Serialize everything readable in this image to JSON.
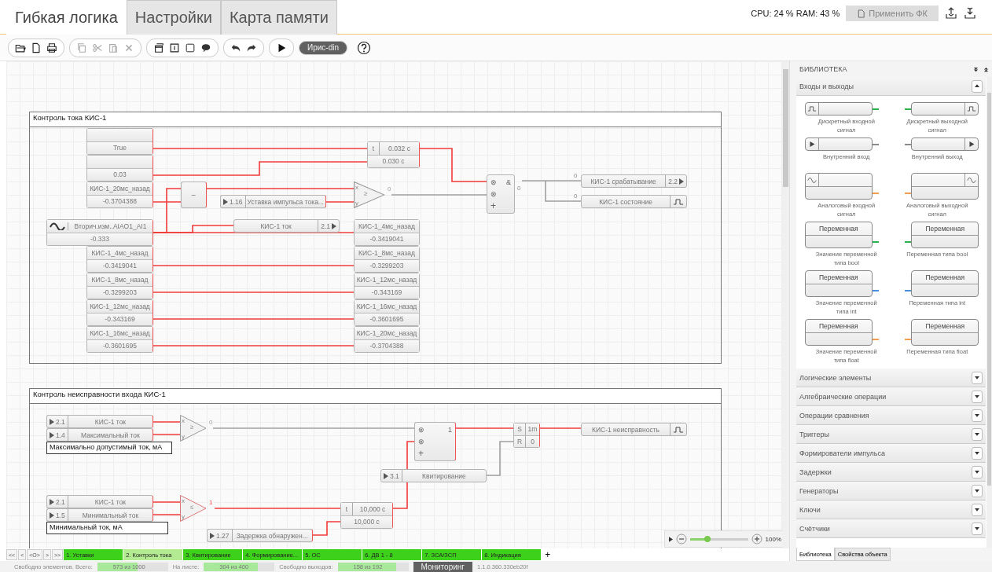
{
  "tabs": [
    {
      "label": "Гибкая логика",
      "selected": true
    },
    {
      "label": "Настройки",
      "selected": false
    },
    {
      "label": "Карта памяти",
      "selected": false
    }
  ],
  "system": {
    "usage": "CPU: 24 % RAM: 43 %",
    "apply_button": "Применить ФК"
  },
  "toolbar": {
    "edit_tools_disabled": true,
    "mode_button": "Ирис-din"
  },
  "diagram": {
    "groups": [
      {
        "title": "Контроль тока КИС-1"
      },
      {
        "title": "Контроль неисправности входа КИС-1"
      }
    ],
    "blocks": [
      {
        "kind": "const",
        "value": "True",
        "active": true
      },
      {
        "kind": "delay",
        "symbol": "t",
        "value": "0.032 с",
        "setting": "0.030 с",
        "active": true
      },
      {
        "kind": "const",
        "value": "0.03",
        "active": true
      },
      {
        "kind": "and",
        "inputs": [
          "⊗",
          "⊗"
        ],
        "symbol": "&",
        "add": "+",
        "output": "0",
        "active": false
      },
      {
        "kind": "outref",
        "label": "КИС-1 срабатывание",
        "number": "2.2",
        "input": "0"
      },
      {
        "kind": "var",
        "label": "КИС-1_20мс_назад",
        "value": "-0.3704388",
        "active": true
      },
      {
        "kind": "sub",
        "symbol": "−",
        "active": true
      },
      {
        "kind": "ref",
        "number": "1.16",
        "label": "Уставка импульса тока...",
        "active": true
      },
      {
        "kind": "compare",
        "x": "x",
        "y": "y",
        "symbol": "≥",
        "output": "0",
        "active": false
      },
      {
        "kind": "discrete_out",
        "label": "КИС-1 состояние",
        "input": "0"
      },
      {
        "kind": "analog_in",
        "label": "Вторич.изм..AIAO1_AI1",
        "value": "-0.333",
        "active": true
      },
      {
        "kind": "outref",
        "label": "КИС-1 ток",
        "number": "2.1"
      },
      {
        "kind": "var",
        "label": "КИС-1_4мс_назад",
        "value": "-0.3419041"
      },
      {
        "kind": "var",
        "label": "КИС-1_4мс_назад",
        "value": "-0.3419041",
        "active": true
      },
      {
        "kind": "var",
        "label": "КИС-1_8мс_назад",
        "value": "-0.3299203"
      },
      {
        "kind": "var",
        "label": "КИС-1_8мс_назад",
        "value": "-0.3299203",
        "active": true
      },
      {
        "kind": "var",
        "label": "КИС-1_12мс_назад",
        "value": "-0.343169"
      },
      {
        "kind": "var",
        "label": "КИС-1_12мс_назад",
        "value": "-0.343169",
        "active": true
      },
      {
        "kind": "var",
        "label": "КИС-1_16мс_назад",
        "value": "-0.3601695"
      },
      {
        "kind": "var",
        "label": "КИС-1_16мс_назад",
        "value": "-0.3601695",
        "active": true
      },
      {
        "kind": "var",
        "label": "КИС-1_20мс_назад",
        "value": "-0.3704388"
      },
      {
        "kind": "ref",
        "number": "2.1",
        "label": "КИС-1 ток",
        "active": true
      },
      {
        "kind": "compare",
        "x": "x",
        "y": "y",
        "symbol": "≥",
        "output": "0",
        "active": false
      },
      {
        "kind": "and",
        "inputs": [
          "⊗",
          "⊗"
        ],
        "symbol": "1",
        "add": "+",
        "active": true
      },
      {
        "kind": "sr",
        "set": "S",
        "reset": "R",
        "delay": "1m",
        "state": "0",
        "active": true
      },
      {
        "kind": "discrete_out",
        "label": "КИС-1 неисправность"
      },
      {
        "kind": "ref",
        "number": "1.4",
        "label": "Максимальный ток",
        "active": true
      },
      {
        "kind": "note",
        "text": "Максимально допустимый ток, мА"
      },
      {
        "kind": "ref",
        "number": "3.1",
        "label": "Квитирование",
        "active": false
      },
      {
        "kind": "ref",
        "number": "2.1",
        "label": "КИС-1 ток",
        "active": true
      },
      {
        "kind": "ref",
        "number": "1.5",
        "label": "Минимальный ток",
        "active": true
      },
      {
        "kind": "compare",
        "x": "x",
        "y": "y",
        "symbol": "≤",
        "output": "1",
        "active": true
      },
      {
        "kind": "delay",
        "symbol": "t",
        "value": "10,000 с",
        "setting": "10,000 с",
        "active": true
      },
      {
        "kind": "note",
        "text": "Минимальный ток, мА"
      },
      {
        "kind": "ref",
        "number": "1.27",
        "label": "Задержка обнаружен...",
        "active": true
      }
    ],
    "zoom": {
      "level": 0.3,
      "value": "100%"
    }
  },
  "library": {
    "title": "БИБЛИОТЕКА",
    "sections": [
      {
        "title": "Входы и выходы",
        "expanded": true,
        "items": [
          {
            "kind": "discrete_in",
            "label": "Дискретный входной сигнал",
            "color": "#2bb24c"
          },
          {
            "kind": "discrete_out",
            "label": "Дискретный выходной сигнал",
            "color": "#2bb24c"
          },
          {
            "kind": "internal_in",
            "label": "Внутренний вход",
            "color": "#8a8a8a"
          },
          {
            "kind": "internal_out",
            "label": "Внутренний выход",
            "color": "#8a8a8a"
          },
          {
            "kind": "analog_in",
            "label": "Аналоговый входной сигнал",
            "color": "#f0a050"
          },
          {
            "kind": "analog_out",
            "label": "Аналоговый выходной сигнал",
            "color": "#f0a050"
          },
          {
            "kind": "var_in",
            "header": "Переменная",
            "label": "Значение переменной типа bool",
            "color": "#2bb24c"
          },
          {
            "kind": "var_out",
            "header": "Переменная",
            "label": "Переменная типа bool",
            "color": "#2bb24c"
          },
          {
            "kind": "var_in",
            "header": "Переменная",
            "label": "Значение переменной типа int",
            "color": "#4a90e2"
          },
          {
            "kind": "var_out",
            "header": "Переменная",
            "label": "Переменная типа int",
            "color": "#4a90e2"
          },
          {
            "kind": "var_in",
            "header": "Переменная",
            "label": "Значение переменной типа float",
            "color": "#f0a050"
          },
          {
            "kind": "var_out",
            "header": "Переменная",
            "label": "Переменная типа float",
            "color": "#f0a050"
          }
        ]
      },
      {
        "title": "Логические элементы",
        "expanded": false
      },
      {
        "title": "Алгебраические операции",
        "expanded": false
      },
      {
        "title": "Операции сравнения",
        "expanded": false
      },
      {
        "title": "Триггеры",
        "expanded": false
      },
      {
        "title": "Формирователи импульса",
        "expanded": false
      },
      {
        "title": "Задержки",
        "expanded": false
      },
      {
        "title": "Генераторы",
        "expanded": false
      },
      {
        "title": "Ключи",
        "expanded": false
      },
      {
        "title": "Счётчики",
        "expanded": false
      }
    ],
    "tabs": [
      {
        "label": "Библиотека",
        "selected": true
      },
      {
        "label": "Свойства объекта",
        "selected": false
      }
    ]
  },
  "sheets": {
    "nav": [
      "<<",
      "<",
      "<O>",
      ">",
      ">>"
    ],
    "items": [
      {
        "label": "1. Уставки",
        "selected": false
      },
      {
        "label": "2. Контроль тока",
        "selected": true
      },
      {
        "label": "3. Квитирование",
        "selected": false
      },
      {
        "label": "4. Формирование...",
        "selected": false
      },
      {
        "label": "5. ОС",
        "selected": false
      },
      {
        "label": "6. ДВ 1 - 8",
        "selected": false
      },
      {
        "label": "7. ЗСА/ЗСП",
        "selected": false
      },
      {
        "label": "8. Индикация",
        "selected": false
      }
    ],
    "add": "+"
  },
  "status_bar": {
    "meters": [
      {
        "label": "Свободно элементов. Всего:",
        "value": "573 из 1000",
        "level": 0.573
      },
      {
        "label": "На листе:",
        "value": "304 из 400",
        "level": 0.76
      },
      {
        "label": "Свободно выходов:",
        "value": "158 из 192",
        "level": 0.823
      }
    ],
    "mode": "Мониторинг",
    "version": "1.1.0.360.330eb20f"
  }
}
